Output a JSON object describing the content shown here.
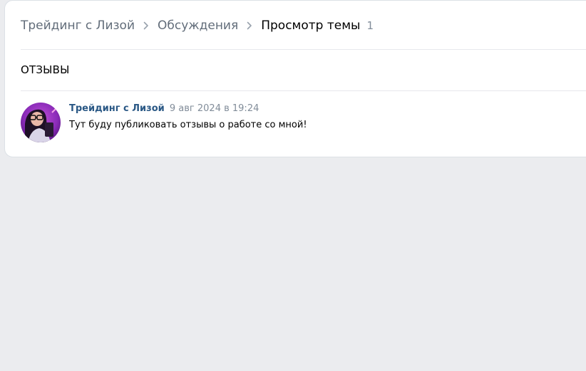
{
  "breadcrumbs": {
    "items": [
      {
        "label": "Трейдинг с Лизой"
      },
      {
        "label": "Обсуждения"
      }
    ],
    "current": "Просмотр темы",
    "count": "1"
  },
  "topic": {
    "title": "ОТЗЫВЫ"
  },
  "post": {
    "author": "Трейдинг с Лизой",
    "date": "9 авг 2024 в 19:24",
    "text": "Тут буду публиковать отзывы о работе со мной!"
  },
  "colors": {
    "page_background": "#EBECEF",
    "card_background": "#FFFFFF",
    "link": "#2A5885",
    "secondary_text": "#818C99",
    "breadcrumb_link": "#626D7A",
    "divider": "#E7E8EC"
  }
}
